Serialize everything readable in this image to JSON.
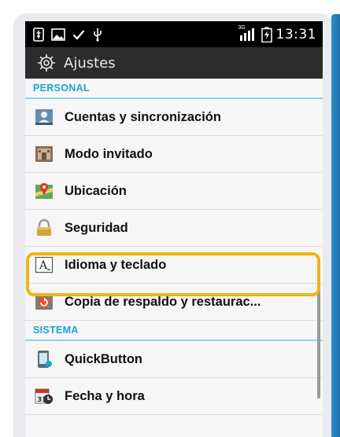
{
  "status_bar": {
    "time": "13:31",
    "network_label": "3G",
    "left_icons": [
      "usb-debug-icon",
      "image-icon",
      "check-icon",
      "usb-icon"
    ],
    "right_icons": [
      "signal-icon",
      "battery-charging-icon"
    ]
  },
  "action_bar": {
    "title": "Ajustes",
    "icon": "gear-icon"
  },
  "sections": [
    {
      "header": "PERSONAL",
      "items": [
        {
          "label": "Cuentas y sincronización",
          "icon": "accounts-icon"
        },
        {
          "label": "Modo invitado",
          "icon": "guest-mode-icon"
        },
        {
          "label": "Ubicación",
          "icon": "location-icon"
        },
        {
          "label": "Seguridad",
          "icon": "lock-icon"
        },
        {
          "label": "Idioma y teclado",
          "icon": "language-keyboard-icon"
        },
        {
          "label": "Copia de respaldo y restaurac...",
          "icon": "backup-restore-icon"
        }
      ]
    },
    {
      "header": "SISTEMA",
      "items": [
        {
          "label": "QuickButton",
          "icon": "quickbutton-icon"
        },
        {
          "label": "Fecha y hora",
          "icon": "calendar-clock-icon"
        }
      ]
    }
  ],
  "colors": {
    "accent": "#1aa3d6",
    "highlight": "#f0b417",
    "action_bar": "#2b2b2b",
    "frame_edge": "#1b6fa8"
  }
}
